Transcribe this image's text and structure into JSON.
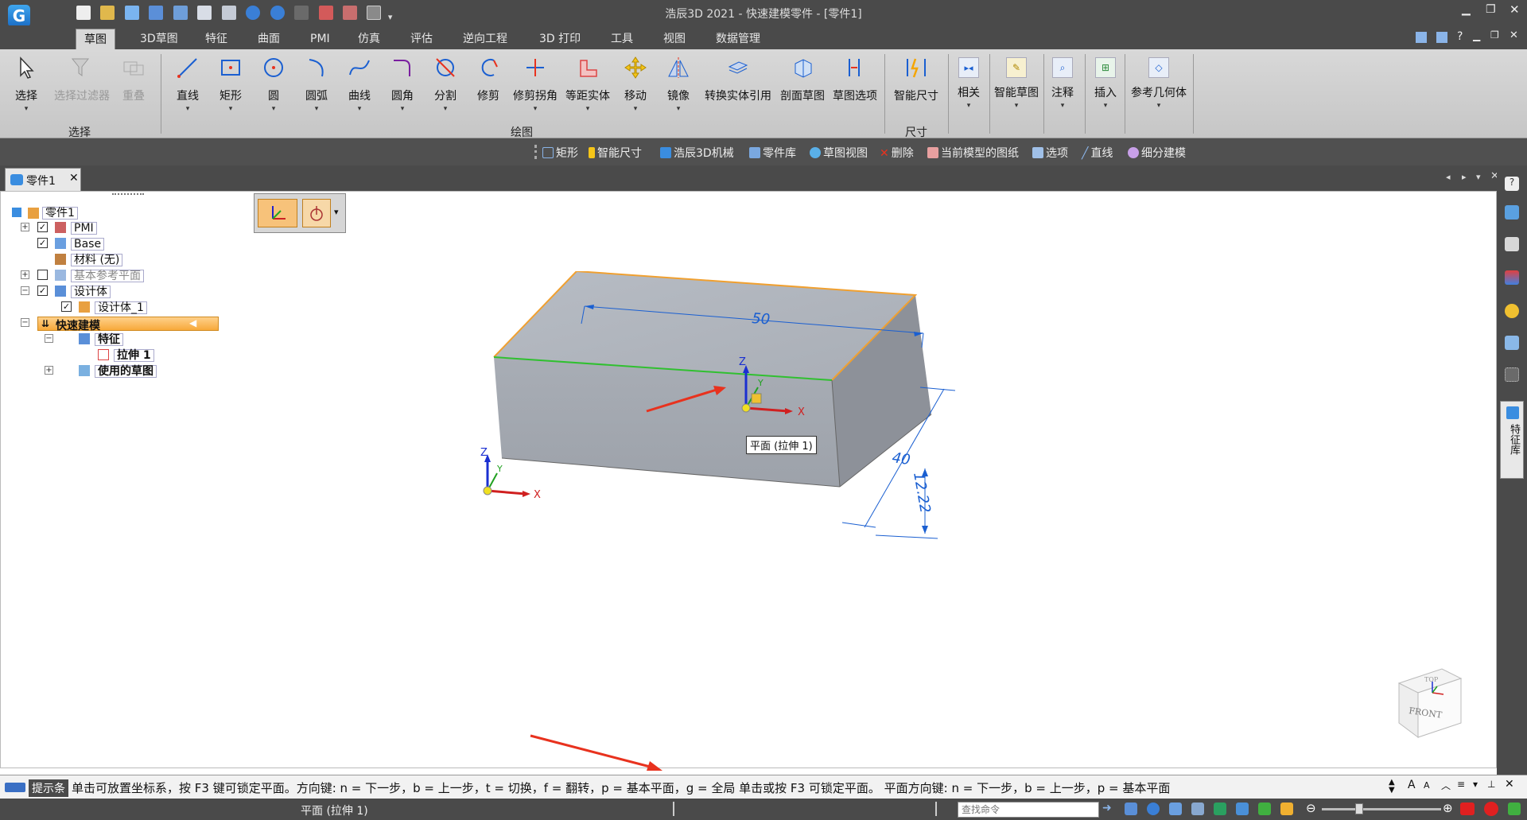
{
  "window": {
    "title": "浩辰3D 2021 - 快速建模零件 - [零件1]"
  },
  "menu_tabs": [
    "草图",
    "3D草图",
    "特征",
    "曲面",
    "PMI",
    "仿真",
    "评估",
    "逆向工程",
    "3D 打印",
    "工具",
    "视图",
    "数据管理"
  ],
  "active_tab": "草图",
  "ribbon": {
    "select_group": {
      "label": "选择",
      "buttons": [
        "选择",
        "选择过滤器",
        "重叠"
      ]
    },
    "draw_group": {
      "label": "绘图",
      "buttons": [
        "直线",
        "矩形",
        "圆",
        "圆弧",
        "曲线",
        "圆角",
        "分割",
        "修剪",
        "修剪拐角",
        "等距实体",
        "移动",
        "镜像",
        "转换实体引用",
        "剖面草图",
        "草图选项"
      ]
    },
    "dim_group": {
      "label": "尺寸",
      "buttons": [
        "智能尺寸"
      ]
    },
    "other_buttons": [
      "相关",
      "智能草图",
      "注释",
      "插入",
      "参考几何体"
    ]
  },
  "quick_toolbar": [
    "矩形",
    "智能尺寸",
    "浩辰3D机械",
    "零件库",
    "草图视图",
    "删除",
    "当前模型的图纸",
    "选项",
    "直线",
    "细分建模"
  ],
  "doc_tab": "零件1",
  "tree": {
    "root": "零件1",
    "pmi": "PMI",
    "base": "Base",
    "material": "材料 (无)",
    "ref_planes": "基本参考平面",
    "bodies": "设计体",
    "body1": "设计体_1",
    "quick_model": "快速建模",
    "features": "特征",
    "extrude": "拉伸 1",
    "used_sketches": "使用的草图"
  },
  "viewport": {
    "dim_length": "50",
    "dim_width": "40",
    "dim_height": "12.22",
    "tooltip": "平面 (拉伸 1)",
    "view_cube_front": "FRONT",
    "view_cube_top": "TOP",
    "axis_x": "X",
    "axis_y": "Y",
    "axis_z": "Z"
  },
  "right_panel_tab": "特征库",
  "prompt": {
    "label": "提示条",
    "text": "单击可放置坐标系，按 F3 键可锁定平面。方向键: n = 下一步，b = 上一步，t = 切换，f = 翻转，p = 基本平面，g = 全局  单击或按 F3 可锁定平面。  平面方向键: n = 下一步，b = 上一步，p = 基本平面"
  },
  "status": {
    "selection": "平面 (拉伸 1)",
    "search_placeholder": "查找命令"
  },
  "colors": {
    "ui_dark": "#4a4a4a",
    "ribbon_bg": "#d0d0d0",
    "tree_highlight": "#f7b24b",
    "dimension_blue": "#1a5fd1",
    "arrow_red": "#e8321e"
  }
}
